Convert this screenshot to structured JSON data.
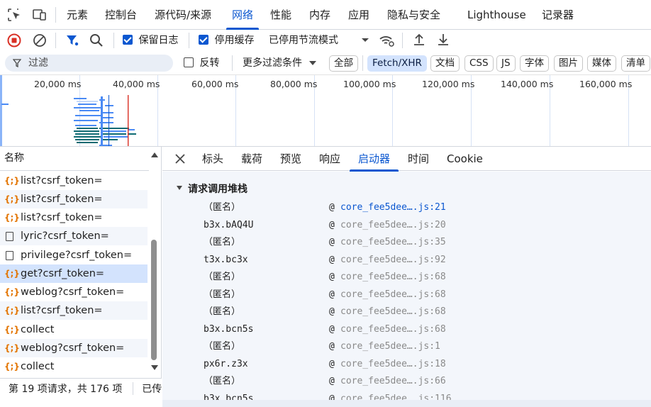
{
  "top_tabs": [
    "元素",
    "控制台",
    "源代码/来源",
    "网络",
    "性能",
    "内存",
    "应用",
    "隐私与安全",
    "Lighthouse",
    "记录器"
  ],
  "active_tab": "网络",
  "toolbar": {
    "preserve_log_label": "保留日志",
    "preserve_log_checked": true,
    "disable_cache_label": "停用缓存",
    "disable_cache_checked": true,
    "throttle_value": "已停用节流模式"
  },
  "filter": {
    "placeholder": "过滤",
    "invert_label": "反转",
    "more_filters_label": "更多过滤条件",
    "chips": [
      "全部",
      "Fetch/XHR",
      "文档",
      "CSS",
      "JS",
      "字体",
      "图片",
      "媒体",
      "清单"
    ],
    "selected_chip": "Fetch/XHR"
  },
  "overview": {
    "ticks": [
      "20,000 ms",
      "40,000 ms",
      "60,000 ms",
      "80,000 ms",
      "100,000 ms",
      "120,000 ms",
      "140,000 ms",
      "160,000 ms"
    ]
  },
  "request_list": {
    "header": "名称",
    "rows": [
      {
        "name": "list?csrf_token=",
        "type": "xhr"
      },
      {
        "name": "list?csrf_token=",
        "type": "xhr"
      },
      {
        "name": "list?csrf_token=",
        "type": "xhr"
      },
      {
        "name": "lyric?csrf_token=",
        "type": "doc"
      },
      {
        "name": "privilege?csrf_token=",
        "type": "doc"
      },
      {
        "name": "get?csrf_token=",
        "type": "xhr",
        "selected": true
      },
      {
        "name": "weblog?csrf_token=",
        "type": "xhr"
      },
      {
        "name": "list?csrf_token=",
        "type": "xhr"
      },
      {
        "name": "collect",
        "type": "xhr"
      },
      {
        "name": "weblog?csrf_token=",
        "type": "xhr"
      },
      {
        "name": "collect",
        "type": "xhr"
      }
    ],
    "status": "第 19 项请求，共 176 项",
    "status_extra": "已传"
  },
  "detail": {
    "tabs": [
      "标头",
      "载荷",
      "预览",
      "响应",
      "启动器",
      "时间",
      "Cookie"
    ],
    "active_tab": "启动器",
    "section_title": "请求调用堆栈",
    "frames": [
      {
        "fn": "（匿名）",
        "at": "@",
        "loc": "core_fee5dee….js:21",
        "link": true
      },
      {
        "fn": "b3x.bAQ4U",
        "at": "@",
        "loc": "core_fee5dee….js:20"
      },
      {
        "fn": "（匿名）",
        "at": "@",
        "loc": "core_fee5dee….js:35"
      },
      {
        "fn": "t3x.bc3x",
        "at": "@",
        "loc": "core_fee5dee….js:92"
      },
      {
        "fn": "（匿名）",
        "at": "@",
        "loc": "core_fee5dee….js:68"
      },
      {
        "fn": "（匿名）",
        "at": "@",
        "loc": "core_fee5dee….js:68"
      },
      {
        "fn": "（匿名）",
        "at": "@",
        "loc": "core_fee5dee….js:68"
      },
      {
        "fn": "b3x.bcn5s",
        "at": "@",
        "loc": "core_fee5dee….js:68"
      },
      {
        "fn": "（匿名）",
        "at": "@",
        "loc": "core_fee5dee….js:1"
      },
      {
        "fn": "px6r.z3x",
        "at": "@",
        "loc": "core_fee5dee….js:18"
      },
      {
        "fn": "（匿名）",
        "at": "@",
        "loc": "core_fee5dee….js:66"
      },
      {
        "fn": "b3x.bcn5s",
        "at": "@",
        "loc": "core_fee5dee….js:116"
      }
    ]
  },
  "colors": {
    "accent": "#0b57d0",
    "record": "#d93025",
    "xhr_icon": "#e37400"
  }
}
